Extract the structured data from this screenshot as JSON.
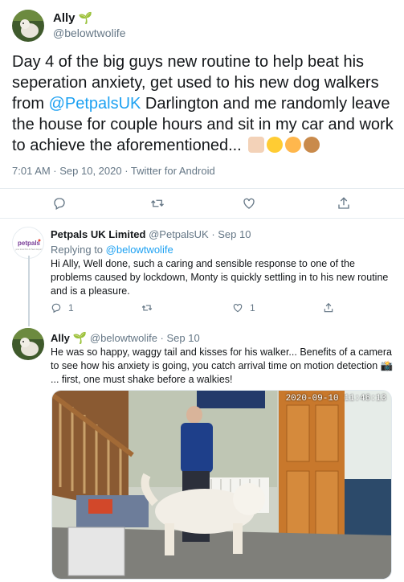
{
  "main_tweet": {
    "name": "Ally",
    "name_emoji": "🌱",
    "handle": "@belowtwolife",
    "text_part1": "Day 4 of the big guys new routine to help beat his seperation anxiety, get used to his new dog walkers from ",
    "mention": "@PetpalsUK",
    "text_part2": " Darlington and me randomly leave the house for couple hours and sit in my car and work to achieve the aforementioned... ",
    "meta": "7:01 AM · Sep 10, 2020 · Twitter for Android"
  },
  "reply1": {
    "name": "Petpals UK Limited",
    "handle_time": "@PetpalsUK · Sep 10",
    "replying_label": "Replying to ",
    "replying_to": "@belowtwolife",
    "text": "Hi Ally, Well done, such a caring and sensible response to one of the problems caused by lockdown, Monty is quickly settling in to his new routine and is a pleasure.",
    "reply_count": "1",
    "like_count": "1",
    "avatar_logo": "petpals",
    "avatar_tagline": "your local Pet & Pawn Expert"
  },
  "reply2": {
    "name": "Ally",
    "name_emoji": "🌱",
    "handle_time": "@belowtwolife · Sep 10",
    "text": "He was so happy, waggy tail and kisses for his walker... Benefits of a camera to see how his anxiety is going, you catch arrival time on motion detection 📸 ...  first, one must shake before a walkies!",
    "media_timestamp": "2020-09-10 11:46:13"
  },
  "icons": {
    "reply": "reply-icon",
    "retweet": "retweet-icon",
    "like": "heart-icon",
    "share": "share-icon"
  },
  "colors": {
    "link": "#1da1f2",
    "secondary_text": "#657786",
    "sprout": "#5aa524"
  }
}
